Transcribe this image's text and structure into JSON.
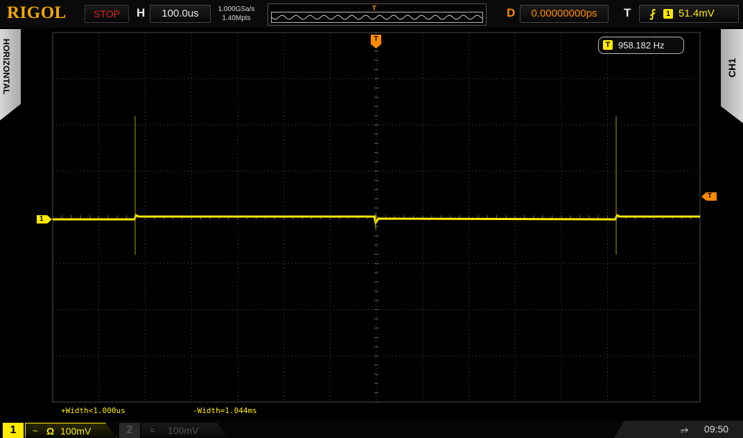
{
  "header": {
    "logo": "RIGOL",
    "run_status": "STOP",
    "horizontal_label": "H",
    "timebase": "100.0us",
    "sample_rate": "1.000GSa/s",
    "memory_depth": "1.40Mpts",
    "delay_label": "D",
    "delay_value": "0.00000000ps",
    "trigger_label": "T",
    "trigger_edge_icon": "rising-edge-icon",
    "trigger_source": "1",
    "trigger_level": "51.4mV"
  },
  "side_tabs": {
    "left": "HORIZONTAL",
    "right": "CH1"
  },
  "display": {
    "grid": {
      "h_divisions": 14,
      "v_divisions": 8
    },
    "frequency_counter": {
      "source": "T",
      "value": "958.182 Hz"
    },
    "channel_marker": "1",
    "trigger_level_marker": "T",
    "trigger_position_marker": "T",
    "trace_color": "#ffea00"
  },
  "measurements": {
    "positive_width": "+Width<1.000us",
    "negative_width": "-Width=1.044ms"
  },
  "channels": {
    "ch1": {
      "number": "1",
      "coupling": "~",
      "impedance": "Ω",
      "scale": "100mV",
      "active": true,
      "color": "#ffea00"
    },
    "ch2": {
      "number": "2",
      "coupling": "=",
      "scale": "100mV",
      "active": false
    }
  },
  "status": {
    "usb_icon": "usb-icon",
    "time": "09:50"
  },
  "colors": {
    "logo": "#f4a800",
    "stop": "#e02020",
    "trigger_accent": "#ff8a00",
    "ch1": "#ffea00",
    "grid": "#555555"
  }
}
